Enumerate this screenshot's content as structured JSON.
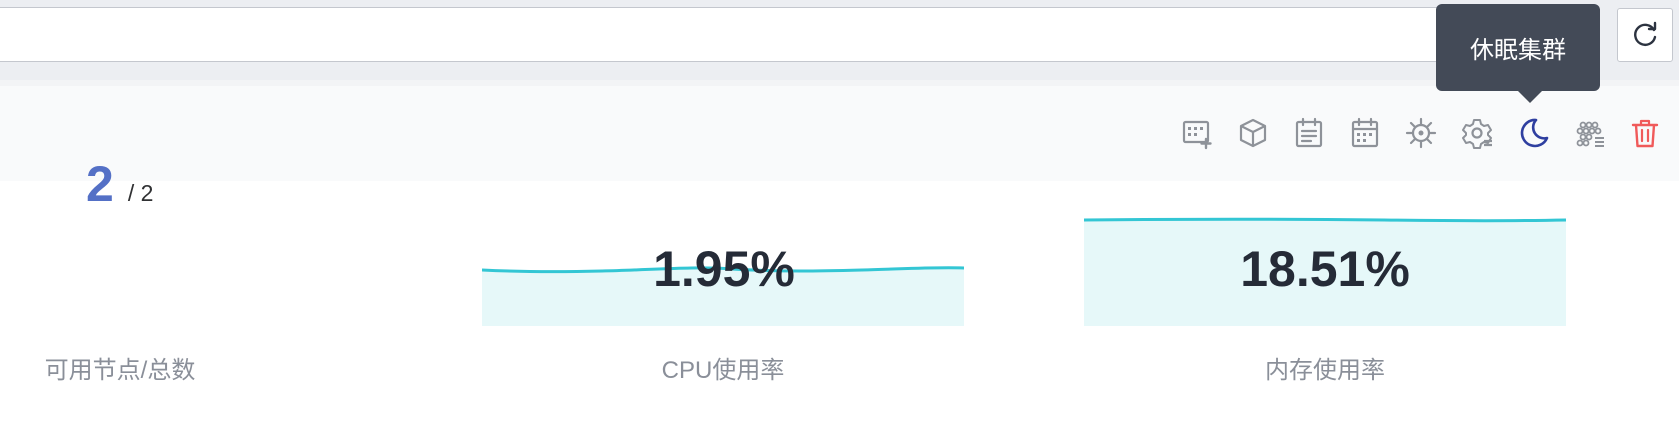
{
  "tooltip": {
    "text": "休眠集群"
  },
  "toolbar": {
    "icons": [
      {
        "name": "add-grid-icon"
      },
      {
        "name": "cube-icon"
      },
      {
        "name": "document-icon"
      },
      {
        "name": "calendar-icon"
      },
      {
        "name": "helm-icon"
      },
      {
        "name": "settings-icon"
      },
      {
        "name": "moon-icon"
      },
      {
        "name": "cluster-icon"
      },
      {
        "name": "trash-icon"
      }
    ],
    "colors": {
      "default": "#8e9299",
      "active": "#2f3fa0",
      "danger": "#f05a5a"
    }
  },
  "metrics": {
    "nodes": {
      "available": "2",
      "total": "/ 2",
      "label": "可用节点/总数"
    },
    "cpu": {
      "value": "1.95%",
      "label": "CPU使用率"
    },
    "memory": {
      "value": "18.51%",
      "label": "内存使用率"
    }
  },
  "colors": {
    "accent": "#5470c6",
    "spark_line": "#33c6d4",
    "spark_fill": "#e6f8f9"
  }
}
